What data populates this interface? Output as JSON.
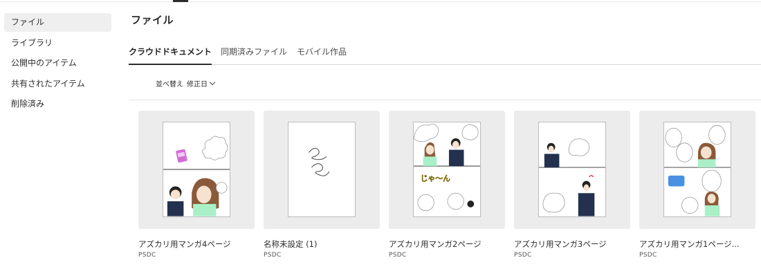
{
  "sidebar": {
    "items": [
      {
        "label": "ファイル"
      },
      {
        "label": "ライブラリ"
      },
      {
        "label": "公開中のアイテム"
      },
      {
        "label": "共有されたアイテム"
      },
      {
        "label": "削除済み"
      }
    ],
    "active_index": 0
  },
  "main": {
    "title": "ファイル",
    "tabs": [
      {
        "label": "クラウドドキュメント",
        "active": true
      },
      {
        "label": "同期済みファイル",
        "active": false
      },
      {
        "label": "モバイル作品",
        "active": false
      }
    ],
    "sort": {
      "label": "並べ替え",
      "value": "修正日"
    }
  },
  "files": [
    {
      "name": "アズカリ用マンガ4ページ",
      "type": "PSDC"
    },
    {
      "name": "名称未設定 (1)",
      "type": "PSDC"
    },
    {
      "name": "アズカリ用マンガ2ページ",
      "type": "PSDC"
    },
    {
      "name": "アズカリ用マンガ3ページ",
      "type": "PSDC"
    },
    {
      "name": "アズカリ用マンガ1ページ...",
      "type": "PSDC"
    }
  ],
  "thumbnail_text": {
    "page2_sfx": "じゃ〜ん"
  },
  "colors": {
    "sidebar_active_bg": "#efefef",
    "thumbnail_bg": "#ececec",
    "text": "#2c2c2c"
  }
}
